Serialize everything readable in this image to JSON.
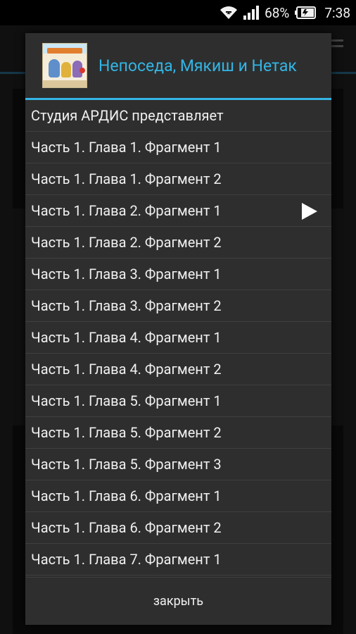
{
  "status_bar": {
    "battery_percent": "68%",
    "time": "7:38"
  },
  "dialog": {
    "title": "Непоседа, Мякиш и Нетак",
    "tracks": [
      {
        "label": "Студия АРДИС представляет",
        "playing": false
      },
      {
        "label": "Часть 1. Глава 1. Фрагмент 1",
        "playing": false
      },
      {
        "label": "Часть 1. Глава 1. Фрагмент 2",
        "playing": false
      },
      {
        "label": "Часть 1. Глава 2. Фрагмент 1",
        "playing": true
      },
      {
        "label": "Часть 1. Глава 2. Фрагмент 2",
        "playing": false
      },
      {
        "label": "Часть 1. Глава 3. Фрагмент 1",
        "playing": false
      },
      {
        "label": "Часть 1. Глава 3. Фрагмент 2",
        "playing": false
      },
      {
        "label": "Часть 1. Глава 4. Фрагмент 1",
        "playing": false
      },
      {
        "label": "Часть 1. Глава 4. Фрагмент 2",
        "playing": false
      },
      {
        "label": "Часть 1. Глава 5. Фрагмент 1",
        "playing": false
      },
      {
        "label": "Часть 1. Глава 5. Фрагмент 2",
        "playing": false
      },
      {
        "label": "Часть 1. Глава 5. Фрагмент 3",
        "playing": false
      },
      {
        "label": "Часть 1. Глава 6. Фрагмент 1",
        "playing": false
      },
      {
        "label": "Часть 1. Глава 6. Фрагмент 2",
        "playing": false
      },
      {
        "label": "Часть 1. Глава 7. Фрагмент 1",
        "playing": false
      }
    ],
    "close_label": "закрыть"
  },
  "colors": {
    "accent": "#33b5e5",
    "dialog_bg": "#2e2e2e",
    "text": "#f0f0f0"
  },
  "icons": {
    "wifi": "wifi-icon",
    "signal": "signal-icon",
    "battery": "battery-icon",
    "play": "play-icon",
    "cover": "book-cover-image"
  }
}
